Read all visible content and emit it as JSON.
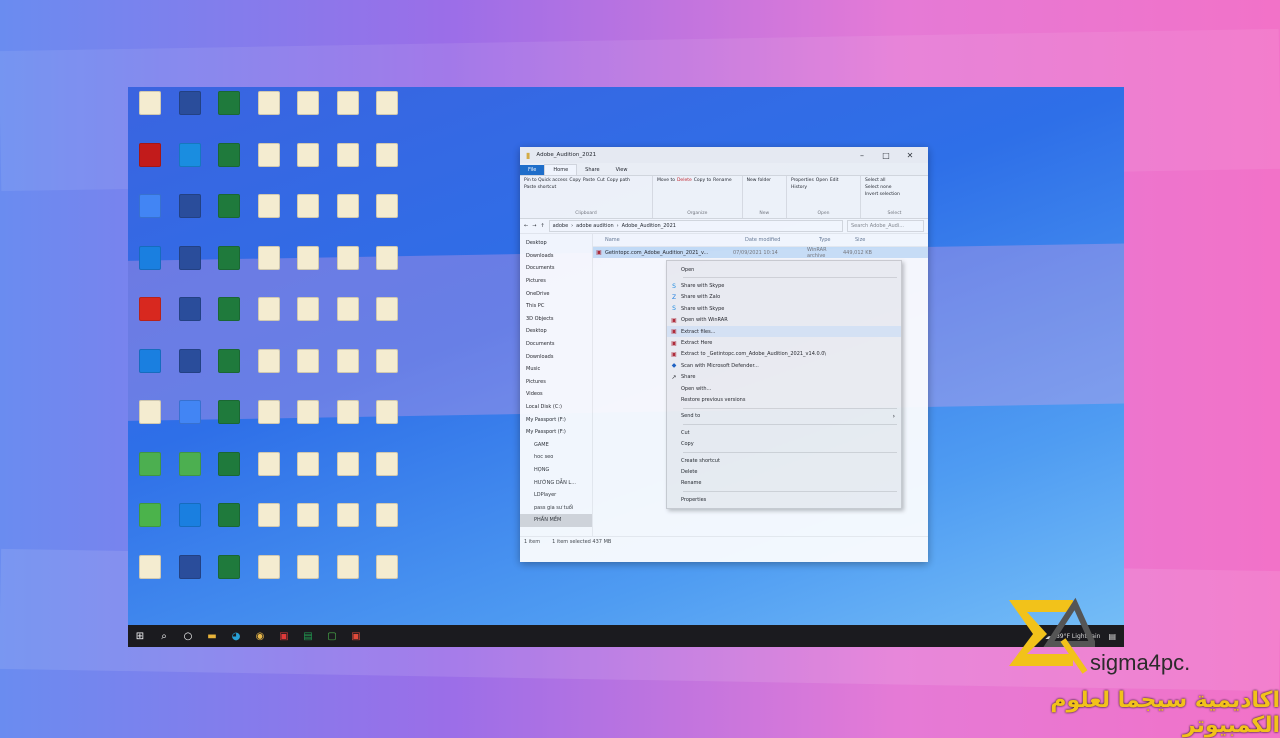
{
  "colors": {
    "accent": "#f2c21a",
    "selection": "#cde3f8",
    "taskbar": "#1b1b1f"
  },
  "explorer": {
    "title": "Adobe_Audition_2021",
    "tabs": [
      "File",
      "Home",
      "Share",
      "View"
    ],
    "ribbon": {
      "clipboard": {
        "pin": "Pin to Quick access",
        "copy": "Copy",
        "paste": "Paste",
        "cut": "Cut",
        "copy_path": "Copy path",
        "paste_shortcut": "Paste shortcut",
        "label": "Clipboard"
      },
      "organize": {
        "move": "Move to",
        "delete": "Delete",
        "copy_to": "Copy to",
        "rename": "Rename",
        "label": "Organize"
      },
      "new": {
        "new_folder": "New folder",
        "label": "New"
      },
      "open": {
        "properties": "Properties",
        "open": "Open",
        "edit": "Edit",
        "history": "History",
        "label": "Open"
      },
      "select": {
        "select_all": "Select all",
        "select_none": "Select none",
        "invert": "Invert selection",
        "label": "Select"
      }
    },
    "crumbs": [
      "adobe",
      "adobe audition",
      "Adobe_Audition_2021"
    ],
    "search_placeholder": "Search Adobe_Audi...",
    "nav": [
      "Desktop",
      "Downloads",
      "Documents",
      "Pictures",
      "OneDrive",
      "This PC",
      "3D Objects",
      "Desktop",
      "Documents",
      "Downloads",
      "Music",
      "Pictures",
      "Videos",
      "Local Disk (C:)",
      "My Passport (F:)",
      "My Passport (F:)",
      "GAME",
      "hoc seo",
      "HỌNG",
      "HƯỚNG DẪN L...",
      "LDPlayer",
      "pass gia sư tuổi",
      "PHẦN MỀM"
    ],
    "columns": [
      "Name",
      "Date modified",
      "Type",
      "Size"
    ],
    "file": {
      "name": "Getintopc.com_Adobe_Audition_2021_v...",
      "date": "07/09/2021 10:14",
      "type": "WinRAR archive",
      "size": "449,012 KB"
    },
    "status": {
      "items": "1 item",
      "selected": "1 item selected  437 MB"
    }
  },
  "context_menu": {
    "items": [
      "Open",
      "Share with Skype",
      "Share with Zalo",
      "Share with Skype",
      "Open with WinRAR",
      "Extract files...",
      "Extract Here",
      "Extract to _Getintopc.com_Adobe_Audition_2021_v14.0.0\\",
      "Scan with Microsoft Defender...",
      "Share",
      "Open with...",
      "Restore previous versions",
      "Send to",
      "Cut",
      "Copy",
      "Create shortcut",
      "Delete",
      "Rename",
      "Properties"
    ]
  },
  "taskbar": {
    "weather": "89°F  Light rain"
  },
  "watermark": {
    "brand": "sigma4pc.",
    "arabic": "اكاديمية سيجما لعلوم الكمبيوتر"
  }
}
